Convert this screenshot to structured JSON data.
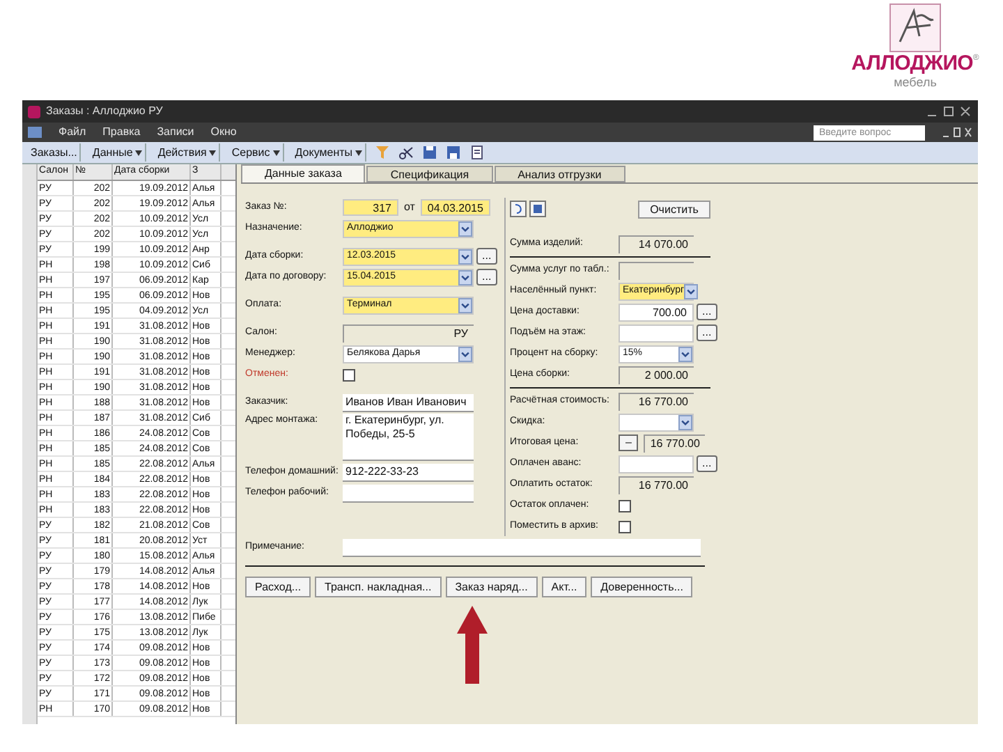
{
  "logo": {
    "name": "АЛЛОДЖИО",
    "mark": "®",
    "tagline": "мебель"
  },
  "window": {
    "title": "Заказы : Аллоджио РУ"
  },
  "menu": [
    "Файл",
    "Правка",
    "Записи",
    "Окно"
  ],
  "help_search": {
    "placeholder": "Введите вопрос"
  },
  "toolbar": [
    {
      "label": "Заказы...",
      "dropdown": false
    },
    {
      "label": "Данные",
      "dropdown": true
    },
    {
      "label": "Действия",
      "dropdown": true
    },
    {
      "label": "Сервис",
      "dropdown": true
    },
    {
      "label": "Документы",
      "dropdown": true
    }
  ],
  "list": {
    "columns": [
      "Салон",
      "№",
      "Дата сборки",
      "З"
    ],
    "rows": [
      [
        "РУ",
        "202",
        "19.09.2012",
        "Алья"
      ],
      [
        "РУ",
        "202",
        "19.09.2012",
        "Алья"
      ],
      [
        "РУ",
        "202",
        "10.09.2012",
        "Усл"
      ],
      [
        "РУ",
        "202",
        "10.09.2012",
        "Усл"
      ],
      [
        "РУ",
        "199",
        "10.09.2012",
        "Анр"
      ],
      [
        "РН",
        "198",
        "10.09.2012",
        "Сиб"
      ],
      [
        "РН",
        "197",
        "06.09.2012",
        "Кар"
      ],
      [
        "РН",
        "195",
        "06.09.2012",
        "Нов"
      ],
      [
        "РН",
        "195",
        "04.09.2012",
        "Усл"
      ],
      [
        "РН",
        "191",
        "31.08.2012",
        "Нов"
      ],
      [
        "РН",
        "190",
        "31.08.2012",
        "Нов"
      ],
      [
        "РН",
        "190",
        "31.08.2012",
        "Нов"
      ],
      [
        "РН",
        "191",
        "31.08.2012",
        "Нов"
      ],
      [
        "РН",
        "190",
        "31.08.2012",
        "Нов"
      ],
      [
        "РН",
        "188",
        "31.08.2012",
        "Нов"
      ],
      [
        "РН",
        "187",
        "31.08.2012",
        "Сиб"
      ],
      [
        "РН",
        "186",
        "24.08.2012",
        "Сов"
      ],
      [
        "РН",
        "185",
        "24.08.2012",
        "Сов"
      ],
      [
        "РН",
        "185",
        "22.08.2012",
        "Алья"
      ],
      [
        "РН",
        "184",
        "22.08.2012",
        "Нов"
      ],
      [
        "РН",
        "183",
        "22.08.2012",
        "Нов"
      ],
      [
        "РН",
        "183",
        "22.08.2012",
        "Нов"
      ],
      [
        "РУ",
        "182",
        "21.08.2012",
        "Сов"
      ],
      [
        "РУ",
        "181",
        "20.08.2012",
        "Уст"
      ],
      [
        "РУ",
        "180",
        "15.08.2012",
        "Алья"
      ],
      [
        "РУ",
        "179",
        "14.08.2012",
        "Алья"
      ],
      [
        "РУ",
        "178",
        "14.08.2012",
        "Нов"
      ],
      [
        "РУ",
        "177",
        "14.08.2012",
        "Лук"
      ],
      [
        "РУ",
        "176",
        "13.08.2012",
        "Пибе"
      ],
      [
        "РУ",
        "175",
        "13.08.2012",
        "Лук"
      ],
      [
        "РУ",
        "174",
        "09.08.2012",
        "Нов"
      ],
      [
        "РУ",
        "173",
        "09.08.2012",
        "Нов"
      ],
      [
        "РУ",
        "172",
        "09.08.2012",
        "Нов"
      ],
      [
        "РУ",
        "171",
        "09.08.2012",
        "Нов"
      ],
      [
        "РН",
        "170",
        "09.08.2012",
        "Нов"
      ]
    ]
  },
  "tabs": [
    {
      "label": "Данные заказа",
      "selected": true
    },
    {
      "label": "Спецификация",
      "selected": false
    },
    {
      "label": "Анализ отгрузки",
      "selected": false
    }
  ],
  "left_groups": [
    [
      {
        "kind": "order_no",
        "label": "Заказ №:",
        "value": "317",
        "between": "от",
        "date": "04.03.2015",
        "highlighted": true
      },
      {
        "kind": "select",
        "label": "Назначение:",
        "value": "Аллоджио",
        "highlighted": true
      }
    ],
    [
      {
        "kind": "select_picker",
        "label": "Дата сборки:",
        "value": "12.03.2015",
        "more": "...",
        "highlighted": true
      },
      {
        "kind": "select_picker",
        "label": "Дата по договору:",
        "value": "15.04.2015",
        "more": "...",
        "highlighted": true
      }
    ],
    [
      {
        "kind": "select",
        "label": "Оплата:",
        "value": "Терминал",
        "highlighted": true
      }
    ],
    [
      {
        "kind": "readout",
        "label": "Салон:",
        "value": "РУ",
        "highlighted": false
      },
      {
        "kind": "select",
        "label": "Менеджер:",
        "value": "Белякова Дарья",
        "highlighted": false
      },
      {
        "kind": "check",
        "label": "Отменен:",
        "checked": false,
        "color": "#c0392b",
        "highlighted": false
      }
    ],
    [
      {
        "kind": "text",
        "label": "Заказчик:",
        "value": "Иванов Иван Иванович",
        "highlighted": false
      },
      {
        "kind": "textarea",
        "label": "Адрес монтажа:",
        "value": "г. Екатеринбург, ул. Победы, 25-5",
        "highlighted": false
      },
      {
        "kind": "text",
        "label": "Телефон домашний:",
        "value": "912-222-33-23",
        "highlighted": false
      },
      {
        "kind": "text",
        "label": "Телефон рабочий:",
        "highlighted": false
      }
    ]
  ],
  "note": {
    "label": "Примечание:"
  },
  "clear_button": "Очистить",
  "right_groups": [
    [
      {
        "kind": "readout",
        "label": "Сумма изделий:",
        "value": "14 070.00",
        "highlighted": false
      }
    ],
    [
      {
        "kind": "readout",
        "label": "Сумма услуг по табл.:",
        "highlighted": false
      },
      {
        "kind": "select",
        "label": "Населённый пункт:",
        "value": "Екатеринбург",
        "highlighted": true
      },
      {
        "kind": "picker",
        "label": "Цена доставки:",
        "value": "700.00",
        "more": "...",
        "highlighted": false
      },
      {
        "kind": "picker",
        "label": "Подъём на этаж:",
        "more": "...",
        "highlighted": false
      },
      {
        "kind": "select",
        "label": "Процент на сборку:",
        "value": "15%",
        "highlighted": false
      },
      {
        "kind": "readout",
        "label": "Цена сборки:",
        "value": "2 000.00",
        "highlighted": false
      }
    ],
    [
      {
        "kind": "readout",
        "label": "Расчётная стоимость:",
        "value": "16 770.00",
        "highlighted": false
      },
      {
        "kind": "select",
        "label": "Скидка:",
        "highlighted": false
      },
      {
        "kind": "minus_readout",
        "label": "Итоговая цена:",
        "button": "–",
        "value": "16 770.00",
        "highlighted": false
      },
      {
        "kind": "picker",
        "label": "Оплачен аванс:",
        "more": "...",
        "highlighted": false
      },
      {
        "kind": "readout",
        "label": "Оплатить остаток:",
        "value": "16 770.00",
        "highlighted": false
      },
      {
        "kind": "check",
        "label": "Остаток оплачен:",
        "checked": false,
        "highlighted": false
      },
      {
        "kind": "check",
        "label": "Поместить в архив:",
        "checked": false,
        "highlighted": false
      }
    ]
  ],
  "documents": [
    "Расход...",
    "Трансп. накладная...",
    "Заказ наряд...",
    "Акт...",
    "Доверенность..."
  ]
}
